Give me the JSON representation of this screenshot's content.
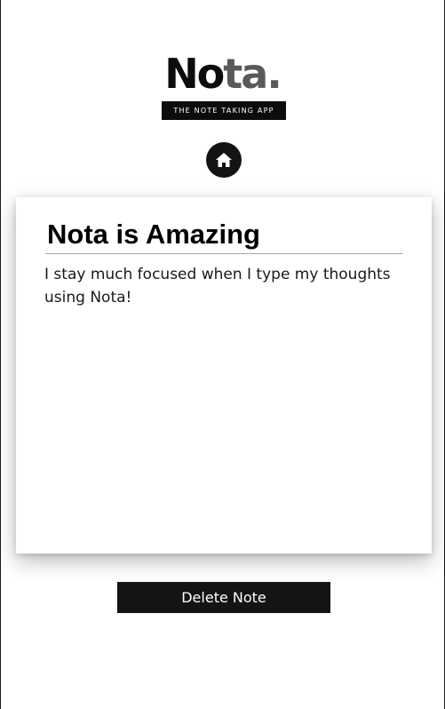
{
  "app": {
    "logo_part1": "No",
    "logo_part2": "ta.",
    "tagline": "THE NOTE TAKING APP"
  },
  "nav": {
    "home_icon": "home-icon"
  },
  "note": {
    "title": "Nota is Amazing",
    "body": "I stay much focused when I type my thoughts using Nota!"
  },
  "actions": {
    "delete_label": "Delete Note"
  },
  "colors": {
    "primary": "#0c0c0c",
    "logo_accent": "#5a5a5a",
    "background": "#ffffff"
  }
}
